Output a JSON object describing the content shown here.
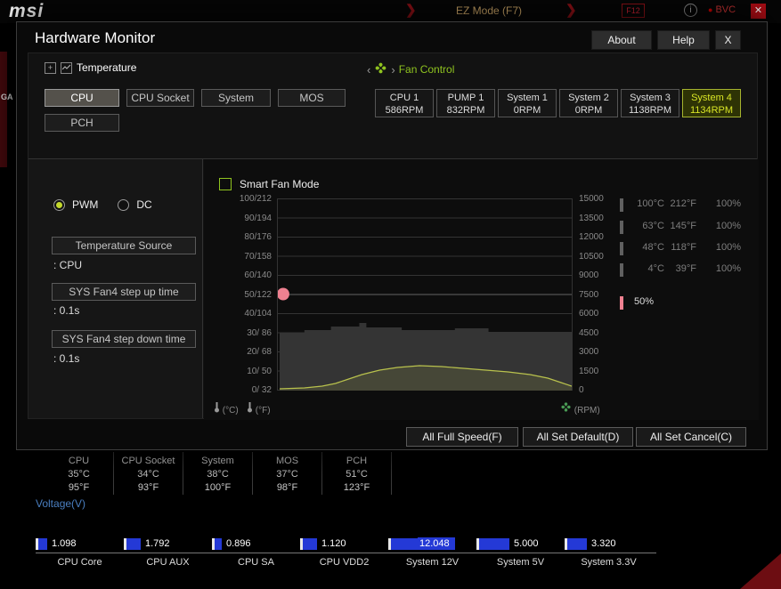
{
  "topbar": {
    "logo": "msi",
    "ez_mode": "EZ Mode (F7)",
    "f12": "F12",
    "info": "i",
    "bvc": "BVC",
    "close": "✕",
    "ga": "GA"
  },
  "modal": {
    "title": "Hardware Monitor",
    "about_btn": "About",
    "help_btn": "Help",
    "close_btn": "X"
  },
  "temperature_section": {
    "title": "Temperature",
    "sources": [
      {
        "label": "CPU",
        "selected": true
      },
      {
        "label": "CPU Socket",
        "selected": false
      },
      {
        "label": "System",
        "selected": false
      },
      {
        "label": "MOS",
        "selected": false
      },
      {
        "label": "PCH",
        "selected": false
      }
    ]
  },
  "fan_section": {
    "title": "Fan Control",
    "fans": [
      {
        "name": "CPU 1",
        "rpm": "586RPM",
        "selected": false
      },
      {
        "name": "PUMP 1",
        "rpm": "832RPM",
        "selected": false
      },
      {
        "name": "System 1",
        "rpm": "0RPM",
        "selected": false
      },
      {
        "name": "System 2",
        "rpm": "0RPM",
        "selected": false
      },
      {
        "name": "System 3",
        "rpm": "1138RPM",
        "selected": false
      },
      {
        "name": "System 4",
        "rpm": "1134RPM",
        "selected": true
      }
    ]
  },
  "controls": {
    "pwm_label": "PWM",
    "dc_label": "DC",
    "mode_selected": "PWM",
    "temp_source_btn": "Temperature Source",
    "temp_source_val": ": CPU",
    "step_up_btn": "SYS Fan4 step up time",
    "step_up_val": ": 0.1s",
    "step_down_btn": "SYS Fan4 step down time",
    "step_down_val": ": 0.1s"
  },
  "chart": {
    "smart_fan_label": "Smart Fan Mode",
    "smart_fan_checked": false,
    "type": "line",
    "left_axis": [
      "100/212",
      "90/194",
      "80/176",
      "70/158",
      "60/140",
      "50/122",
      "40/104",
      "30/ 86",
      "20/ 68",
      "10/ 50",
      "0/ 32"
    ],
    "right_axis": [
      "15000",
      "13500",
      "12000",
      "10500",
      "9000",
      "7500",
      "6000",
      "4500",
      "3000",
      "1500",
      "0"
    ],
    "unit_c": "(°C)",
    "unit_f": "(°F)",
    "unit_rpm": "(RPM)",
    "current_speed_pct": "50%",
    "curve_color": "#b9c24d",
    "dot_color": "#ef8191",
    "area_points": "2,216 2,151 30,151 30,148 60,148 60,144 92,144 92,140 100,140 100,145 140,145 140,148 200,148 200,146 238,146 238,150 332,150 332,216",
    "curve_points": "2,214 30,213 50,211 65,208 80,203 95,198 115,193 135,190 160,188 185,189 210,191 235,193 260,195 285,198 305,202 320,207 332,211",
    "curve_fill_points": "2,214 30,213 50,211 65,208 80,203 95,198 115,193 135,190 160,188 185,189 210,191 235,193 260,195 285,198 305,202 320,207 332,211 332,216 2,216"
  },
  "markers": {
    "rows": [
      {
        "c": "100°C",
        "f": "212°F",
        "pct": "100%"
      },
      {
        "c": "63°C",
        "f": "145°F",
        "pct": "100%"
      },
      {
        "c": "48°C",
        "f": "118°F",
        "pct": "100%"
      },
      {
        "c": "4°C",
        "f": "39°F",
        "pct": "100%"
      }
    ],
    "pink_pct": "50%"
  },
  "actions": {
    "full_speed": "All Full Speed(F)",
    "set_default": "All Set Default(D)",
    "set_cancel": "All Set Cancel(C)"
  },
  "status": {
    "temps": [
      {
        "name": "CPU",
        "c": "35°C",
        "f": "95°F"
      },
      {
        "name": "CPU Socket",
        "c": "34°C",
        "f": "93°F"
      },
      {
        "name": "System",
        "c": "38°C",
        "f": "100°F"
      },
      {
        "name": "MOS",
        "c": "37°C",
        "f": "98°F"
      },
      {
        "name": "PCH",
        "c": "51°C",
        "f": "123°F"
      }
    ],
    "voltage_title": "Voltage(V)",
    "voltages": [
      {
        "name": "CPU Core",
        "value": "1.098",
        "fill": 10
      },
      {
        "name": "CPU AUX",
        "value": "1.792",
        "fill": 16
      },
      {
        "name": "CPU SA",
        "value": "0.896",
        "fill": 8
      },
      {
        "name": "CPU VDD2",
        "value": "1.120",
        "fill": 16
      },
      {
        "name": "System 12V",
        "value": "12.048",
        "fill": 30,
        "highlight": true
      },
      {
        "name": "System 5V",
        "value": "5.000",
        "fill": 34
      },
      {
        "name": "System 3.3V",
        "value": "3.320",
        "fill": 22
      }
    ]
  }
}
